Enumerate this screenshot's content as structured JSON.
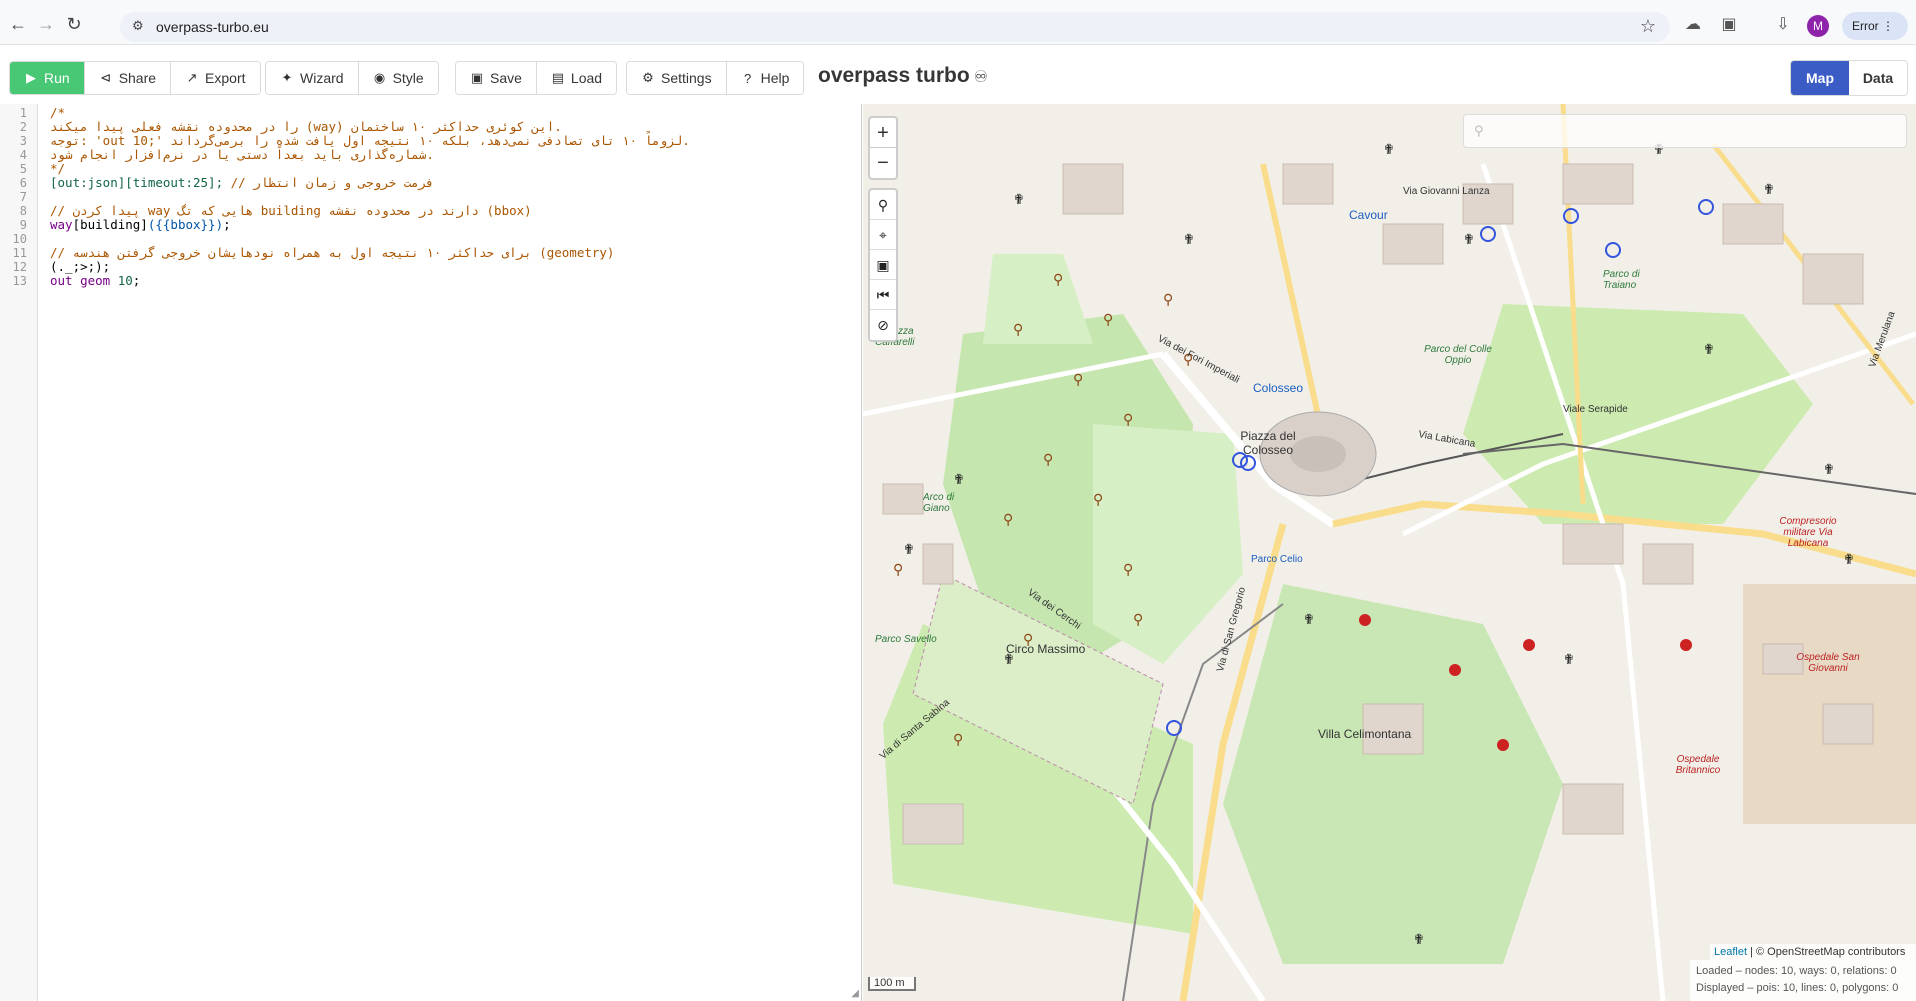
{
  "browser": {
    "url": "overpass-turbo.eu",
    "profile_initial": "M",
    "error_label": "Error"
  },
  "toolbar": {
    "run": "Run",
    "share": "Share",
    "export": "Export",
    "wizard": "Wizard",
    "style": "Style",
    "save": "Save",
    "load": "Load",
    "settings": "Settings",
    "help": "Help",
    "title": "overpass turbo",
    "map_tab": "Map",
    "data_tab": "Data"
  },
  "editor": {
    "line_numbers": [
      "1",
      "2",
      "3",
      "4",
      "5",
      "6",
      "7",
      "8",
      "9",
      "10",
      "11",
      "12",
      "13"
    ],
    "lines": [
      [
        {
          "t": "/*",
          "c": "cm-comment"
        }
      ],
      [
        {
          "t": "را در محدوده نقشه فعلی پیدا میکند (way) این کوئری حداکثر ۱۰ ساختمان.",
          "c": "cm-comment"
        }
      ],
      [
        {
          "t": "توجه: 'out 10;' لزوماً ۱۰ تای تصادفی نمی‌دهد، بلکه ۱۰ نتیجه اول یافت شده را برمی‌گرداند.",
          "c": "cm-comment"
        }
      ],
      [
        {
          "t": "شماره‌گذاری باید بعداً دستی یا در نرم‌افزار انجام شود.",
          "c": "cm-comment"
        }
      ],
      [
        {
          "t": "*/",
          "c": "cm-comment"
        }
      ],
      [
        {
          "t": "[out:json][timeout:25];",
          "c": "cm-bracket"
        },
        {
          "t": " // فرمت خروجی و زمان انتظار",
          "c": "cm-comment"
        }
      ],
      [
        {
          "t": "",
          "c": "cm-plain"
        }
      ],
      [
        {
          "t": "// پیدا کردن way هایی که تگ building دارند در محدوده نقشه (bbox)",
          "c": "cm-comment"
        }
      ],
      [
        {
          "t": "way",
          "c": "cm-kw"
        },
        {
          "t": "[building]",
          "c": "cm-plain"
        },
        {
          "t": "({{bbox}})",
          "c": "cm-var"
        },
        {
          "t": ";",
          "c": "cm-plain"
        }
      ],
      [
        {
          "t": "",
          "c": "cm-plain"
        }
      ],
      [
        {
          "t": "// برای حداکثر ۱۰ نتیجه اول به همراه نودهایشان خروجی گرفتن هندسه (geometry)",
          "c": "cm-comment"
        }
      ],
      [
        {
          "t": "(._;>;);",
          "c": "cm-plain"
        }
      ],
      [
        {
          "t": "out geom ",
          "c": "cm-kw"
        },
        {
          "t": "10",
          "c": "cm-num"
        },
        {
          "t": ";",
          "c": "cm-plain"
        }
      ]
    ]
  },
  "map": {
    "scale_label": "100 m",
    "attribution_leaflet": "Leaflet",
    "attribution_rest": " | © OpenStreetMap contributors",
    "stats_loaded": "Loaded – nodes: 10, ways: 0, relations: 0",
    "stats_displayed": "Displayed – pois: 10, lines: 0, polygons: 0",
    "labels": [
      {
        "text": "Colosseo",
        "cls": "big blue"
      },
      {
        "text": "Piazza del Colosseo",
        "cls": "big"
      },
      {
        "text": "Cavour",
        "cls": "big blue"
      },
      {
        "text": "Circo Massimo",
        "cls": "big"
      },
      {
        "text": "Parco di Traiano",
        "cls": "green"
      },
      {
        "text": "Parco del Colle Oppio",
        "cls": "green"
      },
      {
        "text": "Villa Celimontana",
        "cls": "big"
      },
      {
        "text": "Parco Celio",
        "cls": "blue"
      },
      {
        "text": "Via Labicana",
        "cls": ""
      },
      {
        "text": "Via dei Fori Imperiali",
        "cls": ""
      },
      {
        "text": "Via Giovanni Lanza",
        "cls": ""
      },
      {
        "text": "Via di San Gregorio",
        "cls": ""
      },
      {
        "text": "Via dei Cerchi",
        "cls": ""
      },
      {
        "text": "Ospedale San Giovanni",
        "cls": "red"
      },
      {
        "text": "Ospedale Britannico",
        "cls": "red"
      },
      {
        "text": "Terrazza Caffarelli",
        "cls": "green"
      },
      {
        "text": "Viale Serapide",
        "cls": ""
      },
      {
        "text": "Via Merulana",
        "cls": ""
      },
      {
        "text": "Compresorio militare Via Labicana",
        "cls": "red"
      },
      {
        "text": "Arco di Giano",
        "cls": "green"
      },
      {
        "text": "Via di Santa Sabina",
        "cls": ""
      },
      {
        "text": "Parco Savello",
        "cls": "green"
      }
    ]
  },
  "colors": {
    "run_green": "#48c774",
    "map_tab_blue": "#3b5cc4",
    "map_background": "#f2efe9",
    "park_green": "#cdebb0"
  }
}
